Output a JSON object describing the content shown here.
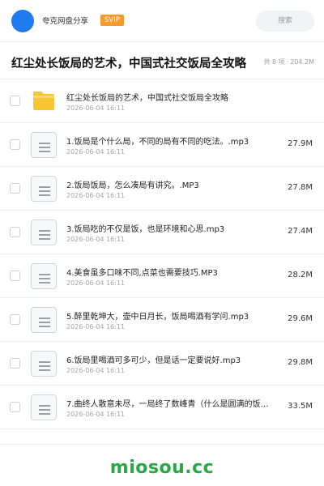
{
  "topbar": {
    "username": "夸克网盘分享",
    "badge": "SVIP",
    "search_placeholder": "搜索"
  },
  "header": {
    "title": "红尘处长饭局的艺术，中国式社交饭局全攻略",
    "count": "共 8 项",
    "separator": "·",
    "total_size": "204.2M"
  },
  "files": [
    {
      "name": "红尘处长饭局的艺术，中国式社交饭局全攻略",
      "date": "2026-06-04 16:11",
      "size": "",
      "type": "folder-icon"
    },
    {
      "name": "1.饭局是个什么局，不同的局有不同的吃法。.mp3",
      "date": "2026-06-04 16:11",
      "size": "27.9M",
      "type": "audio-file-icon"
    },
    {
      "name": "2.饭局饭局，怎么凑局有讲究。.MP3",
      "date": "2026-06-04 16:11",
      "size": "27.8M",
      "type": "audio-file-icon"
    },
    {
      "name": "3.饭局吃的不仅是饭，也是环境和心思.mp3",
      "date": "2026-06-04 16:11",
      "size": "27.4M",
      "type": "audio-file-icon"
    },
    {
      "name": "4.美食虽多口味不同,点菜也需要技巧.MP3",
      "date": "2026-06-04 16:11",
      "size": "28.2M",
      "type": "audio-file-icon"
    },
    {
      "name": "5.醉里乾坤大，壶中日月长，饭局喝酒有学问.mp3",
      "date": "2026-06-04 16:11",
      "size": "29.6M",
      "type": "audio-file-icon"
    },
    {
      "name": "6.饭局里喝酒可多可少，但是话一定要说好.mp3",
      "date": "2026-06-04 16:11",
      "size": "29.8M",
      "type": "audio-file-icon"
    },
    {
      "name": "7.曲终人散意未尽，一局终了数峰青（什么是圆满的饭…",
      "date": "2026-06-04 16:11",
      "size": "33.5M",
      "type": "audio-file-icon"
    }
  ],
  "footer": {
    "watermark": "miosou.cc"
  },
  "colors": {
    "accent": "#1f7cf0",
    "svip": "#f39b2a",
    "folder": "#f7c531",
    "watermark": "#28a745"
  }
}
